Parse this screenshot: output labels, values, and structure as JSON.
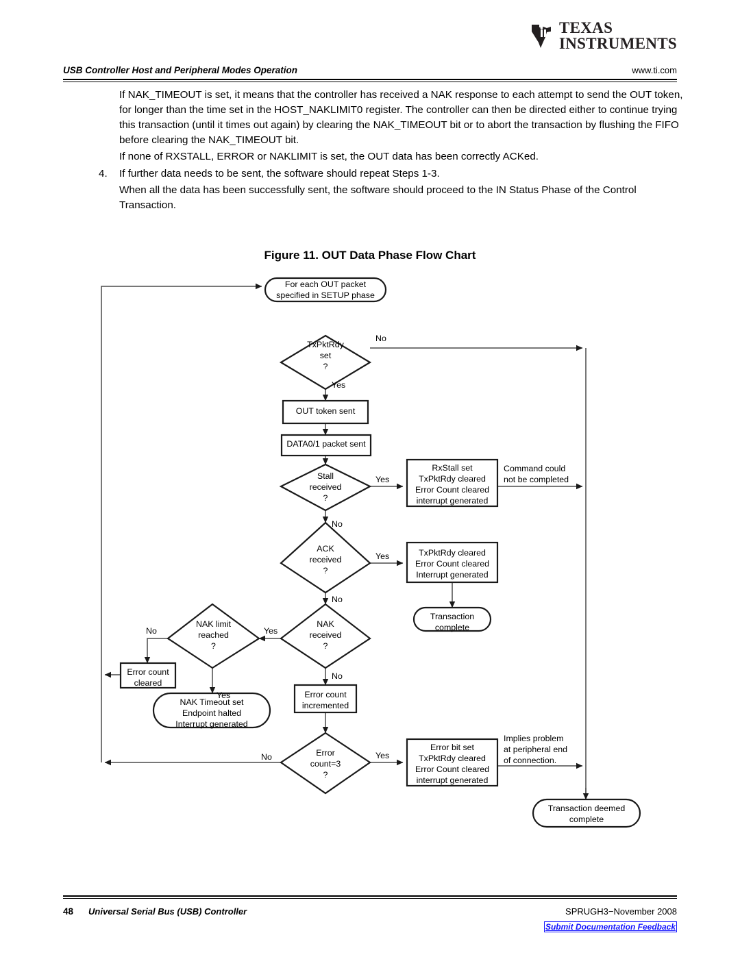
{
  "header": {
    "logo_line1": "TEXAS",
    "logo_line2": "INSTRUMENTS",
    "section_title": "USB Controller Host and Peripheral Modes Operation",
    "website": "www.ti.com"
  },
  "body": {
    "paragraph_1": "If NAK_TIMEOUT is set, it means that the controller has received a NAK response to each attempt to send the OUT token, for longer than the time set in the HOST_NAKLIMIT0 register. The controller can then be directed either to continue trying this transaction (until it times out again) by clearing the NAK_TIMEOUT bit or to abort the transaction by flushing the FIFO before clearing the NAK_TIMEOUT bit.",
    "paragraph_2": "If none of RXSTALL, ERROR or NAKLIMIT is set, the OUT data has been correctly ACKed.",
    "step_4_number": "4.",
    "step_4_text": "If further data needs to be sent, the software should repeat Steps 1-3.",
    "paragraph_3": "When all the data has been successfully sent, the software should proceed to the IN Status Phase of the Control Transaction."
  },
  "figure": {
    "title": "Figure 11. OUT Data Phase Flow Chart"
  },
  "chart_data": {
    "type": "diagram",
    "title": "Figure 11. OUT Data Phase Flow Chart",
    "nodes": [
      {
        "id": "start",
        "shape": "terminator",
        "lines": [
          "For each OUT packet",
          "specified in SETUP phase"
        ]
      },
      {
        "id": "txpktrdy",
        "shape": "decision",
        "lines": [
          "TxPktRdy",
          "set",
          "?"
        ]
      },
      {
        "id": "out_token",
        "shape": "process",
        "lines": [
          "OUT token sent"
        ]
      },
      {
        "id": "data_packet",
        "shape": "process",
        "lines": [
          "DATA0/1 packet sent"
        ]
      },
      {
        "id": "stall",
        "shape": "decision",
        "lines": [
          "Stall",
          "received",
          "?"
        ]
      },
      {
        "id": "rxstall_box",
        "shape": "process",
        "lines": [
          "RxStall set",
          "TxPktRdy cleared",
          "Error Count cleared",
          "interrupt generated"
        ]
      },
      {
        "id": "ack",
        "shape": "decision",
        "lines": [
          "ACK",
          "received",
          "?"
        ]
      },
      {
        "id": "ack_box",
        "shape": "process",
        "lines": [
          "TxPktRdy cleared",
          "Error Count cleared",
          "Interrupt generated"
        ]
      },
      {
        "id": "trans_complete",
        "shape": "terminator",
        "lines": [
          "Transaction",
          "complete"
        ]
      },
      {
        "id": "nak",
        "shape": "decision",
        "lines": [
          "NAK",
          "received",
          "?"
        ]
      },
      {
        "id": "nak_limit",
        "shape": "decision",
        "lines": [
          "NAK limit",
          "reached",
          "?"
        ]
      },
      {
        "id": "err_cleared",
        "shape": "process",
        "lines": [
          "Error count",
          "cleared"
        ]
      },
      {
        "id": "nak_timeout",
        "shape": "terminator",
        "lines": [
          "NAK Timeout set",
          "Endpoint halted",
          "Interrupt generated"
        ]
      },
      {
        "id": "err_incremented",
        "shape": "process",
        "lines": [
          "Error count",
          "incremented"
        ]
      },
      {
        "id": "err_count3",
        "shape": "decision",
        "lines": [
          "Error",
          "count=3",
          "?"
        ]
      },
      {
        "id": "err_bit_box",
        "shape": "process",
        "lines": [
          "Error bit set",
          "TxPktRdy cleared",
          "Error Count cleared",
          "interrupt generated"
        ]
      },
      {
        "id": "trans_deemed",
        "shape": "terminator",
        "lines": [
          "Transaction deemed",
          "complete"
        ]
      }
    ],
    "edge_labels": [
      {
        "id": "txpktrdy_no",
        "text": "No"
      },
      {
        "id": "txpktrdy_yes",
        "text": "Yes"
      },
      {
        "id": "stall_yes",
        "text": "Yes"
      },
      {
        "id": "stall_no",
        "text": "No"
      },
      {
        "id": "ack_yes",
        "text": "Yes"
      },
      {
        "id": "ack_no",
        "text": "No"
      },
      {
        "id": "nak_yes",
        "text": "Yes"
      },
      {
        "id": "nak_no",
        "text": "No"
      },
      {
        "id": "naklimit_no",
        "text": "No"
      },
      {
        "id": "naklimit_yes",
        "text": "Yes"
      },
      {
        "id": "err3_no",
        "text": "No"
      },
      {
        "id": "err3_yes",
        "text": "Yes"
      }
    ],
    "annotations": [
      {
        "id": "cmd_not_completed",
        "lines": [
          "Command could",
          "not be completed"
        ]
      },
      {
        "id": "implies_problem",
        "lines": [
          "Implies problem",
          "at peripheral end",
          "of connection."
        ]
      }
    ]
  },
  "footer": {
    "page_number": "48",
    "doc_title": "Universal Serial Bus (USB) Controller",
    "doc_id": "SPRUGH3−November 2008",
    "feedback_link": "Submit Documentation Feedback"
  }
}
